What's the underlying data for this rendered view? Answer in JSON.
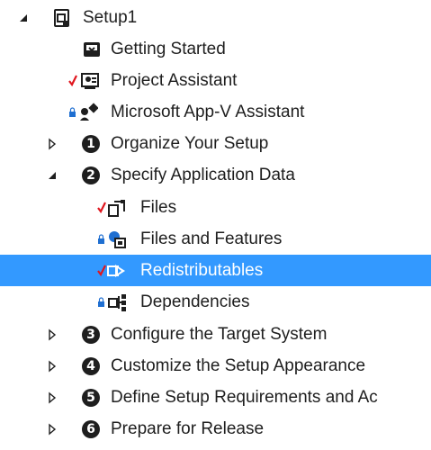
{
  "tree": {
    "root": {
      "label": "Setup1",
      "icon": "setup-project-icon"
    },
    "items": [
      {
        "label": "Getting Started",
        "icon": "getting-started-icon"
      },
      {
        "label": "Project Assistant",
        "icon": "project-assistant-icon",
        "status": "checked"
      },
      {
        "label": "Microsoft App-V Assistant",
        "icon": "appv-assistant-icon",
        "status": "locked"
      },
      {
        "label": "Organize Your Setup",
        "step": "1",
        "expanded": false
      },
      {
        "label": "Specify Application Data",
        "step": "2",
        "expanded": true
      },
      {
        "label": "Files",
        "icon": "files-icon",
        "status": "checked"
      },
      {
        "label": "Files and Features",
        "icon": "files-features-icon",
        "status": "locked"
      },
      {
        "label": "Redistributables",
        "icon": "redistributables-icon",
        "status": "checked",
        "selected": true
      },
      {
        "label": "Dependencies",
        "icon": "dependencies-icon",
        "status": "locked"
      },
      {
        "label": "Configure the Target System",
        "step": "3",
        "expanded": false
      },
      {
        "label": "Customize the Setup Appearance",
        "step": "4",
        "expanded": false
      },
      {
        "label": "Define Setup Requirements and Ac",
        "step": "5",
        "expanded": false
      },
      {
        "label": "Prepare for Release",
        "step": "6",
        "expanded": false
      }
    ]
  },
  "colors": {
    "selection": "#3399ff",
    "check": "#e0161e",
    "lock": "#1f6fd1",
    "text": "#1e1e1e"
  }
}
